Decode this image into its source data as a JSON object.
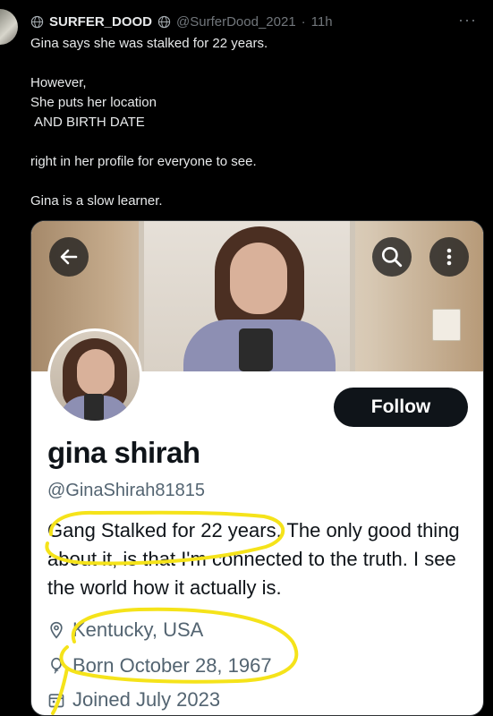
{
  "tweet": {
    "display_name": "SURFER_DOOD",
    "handle": "@SurferDood_2021",
    "separator": "·",
    "time": "11h",
    "more_glyph": "···",
    "text": "Gina says she was stalked for 22 years.\n\nHowever,\nShe puts her location\n AND BIRTH DATE\n\nright in her profile for everyone to see.\n\nGina is a slow learner."
  },
  "profile": {
    "name": "gina shirah",
    "handle": "@GinaShirah81815",
    "bio": "Gang Stalked for 22 years. The only good thing about it, is that I'm connected to the truth. I see the world how it actually is.",
    "location": "Kentucky, USA",
    "born": "Born October 28, 1967",
    "joined": "Joined July 2023",
    "follow_label": "Follow"
  },
  "icons": {
    "back": "arrow-left-icon",
    "search": "search-icon",
    "more": "more-vertical-icon",
    "location": "location-pin-icon",
    "born": "balloon-icon",
    "joined": "calendar-icon",
    "verified_globe": "globe-icon"
  },
  "colors": {
    "highlight": "#f5e31a",
    "follow_bg": "#0f1419",
    "muted": "#536471"
  }
}
